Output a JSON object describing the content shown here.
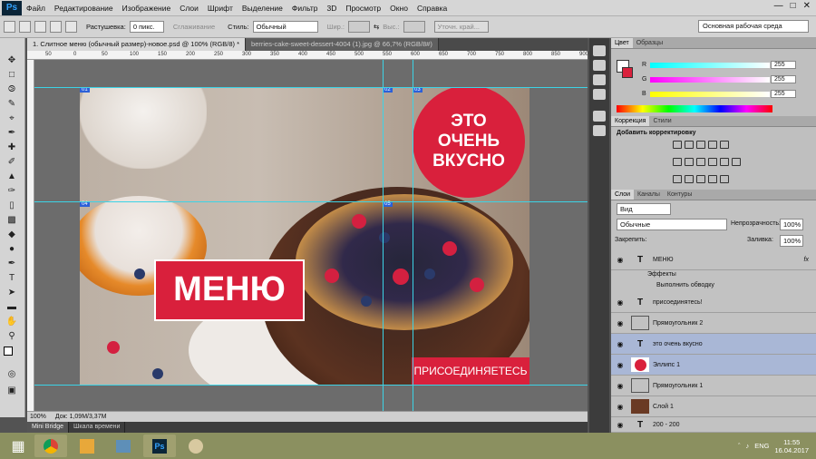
{
  "app": {
    "logo": "Ps"
  },
  "menu": [
    "Файл",
    "Редактирование",
    "Изображение",
    "Слои",
    "Шрифт",
    "Выделение",
    "Фильтр",
    "3D",
    "Просмотр",
    "Окно",
    "Справка"
  ],
  "options": {
    "feather_label": "Растушевка:",
    "feather_value": "0 пикс.",
    "smooth_label": "Сглаживание",
    "style_label": "Стиль:",
    "style_value": "Обычный",
    "width_label": "Шир.:",
    "height_label": "Выс.:",
    "refine_label": "Уточн. край...",
    "workspace": "Основная рабочая среда"
  },
  "tabs": [
    "1. Слитное меню (обычный размер)-новое.psd @ 100% (RGB/8) *",
    "berries-cake-sweet-dessert-4004 (1).jpg @ 66,7% (RGB/8#)"
  ],
  "ruler_ticks": [
    "50",
    "0",
    "50",
    "100",
    "150",
    "200",
    "250",
    "300",
    "350",
    "400",
    "450",
    "500",
    "550",
    "600",
    "650",
    "700",
    "750",
    "800",
    "850",
    "900"
  ],
  "slices": [
    "01",
    "02",
    "03",
    "04",
    "05"
  ],
  "design": {
    "circle_line1": "ЭТО",
    "circle_line2": "ОЧЕНЬ",
    "circle_line3": "ВКУСНО",
    "menu_text": "МЕНЮ",
    "join_text": "ПРИСОЕДИНЯЕТЕСЬ",
    "brand_color": "#d9203c"
  },
  "status": {
    "zoom": "100%",
    "doc": "Док: 1,09M/3,37M"
  },
  "bottom_tabs": [
    "Mini Bridge",
    "Шкала времени"
  ],
  "color_panel": {
    "tabs": [
      "Цвет",
      "Образцы"
    ],
    "r_label": "R",
    "g_label": "G",
    "b_label": "B",
    "r": "255",
    "g": "255",
    "b": "255"
  },
  "adjust_panel": {
    "tabs": [
      "Коррекция",
      "Стили"
    ],
    "title": "Добавить корректировку"
  },
  "layers_panel": {
    "tabs": [
      "Слои",
      "Каналы",
      "Контуры"
    ],
    "kind": "Вид",
    "blend": "Обычные",
    "opacity_label": "Непрозрачность:",
    "opacity": "100%",
    "lock_label": "Закрепить:",
    "fill_label": "Заливка:",
    "fill": "100%",
    "layers": [
      {
        "name": "МЕНЮ",
        "type": "text",
        "fx": "fx"
      },
      {
        "name": "Эффекты",
        "type": "sub"
      },
      {
        "name": "Выполнить обводку",
        "type": "sub2"
      },
      {
        "name": "присоединятесь!",
        "type": "text"
      },
      {
        "name": "Прямоугольник 2",
        "type": "shape"
      },
      {
        "name": "это очень вкусно",
        "type": "text"
      },
      {
        "name": "Эллипс 1",
        "type": "shape"
      },
      {
        "name": "Прямоугольник 1",
        "type": "shape"
      },
      {
        "name": "Слой 1",
        "type": "image"
      },
      {
        "name": "200 - 200",
        "type": "text"
      }
    ]
  },
  "taskbar": {
    "time": "11:55",
    "date": "16.04.2017",
    "lang": "ENG"
  }
}
